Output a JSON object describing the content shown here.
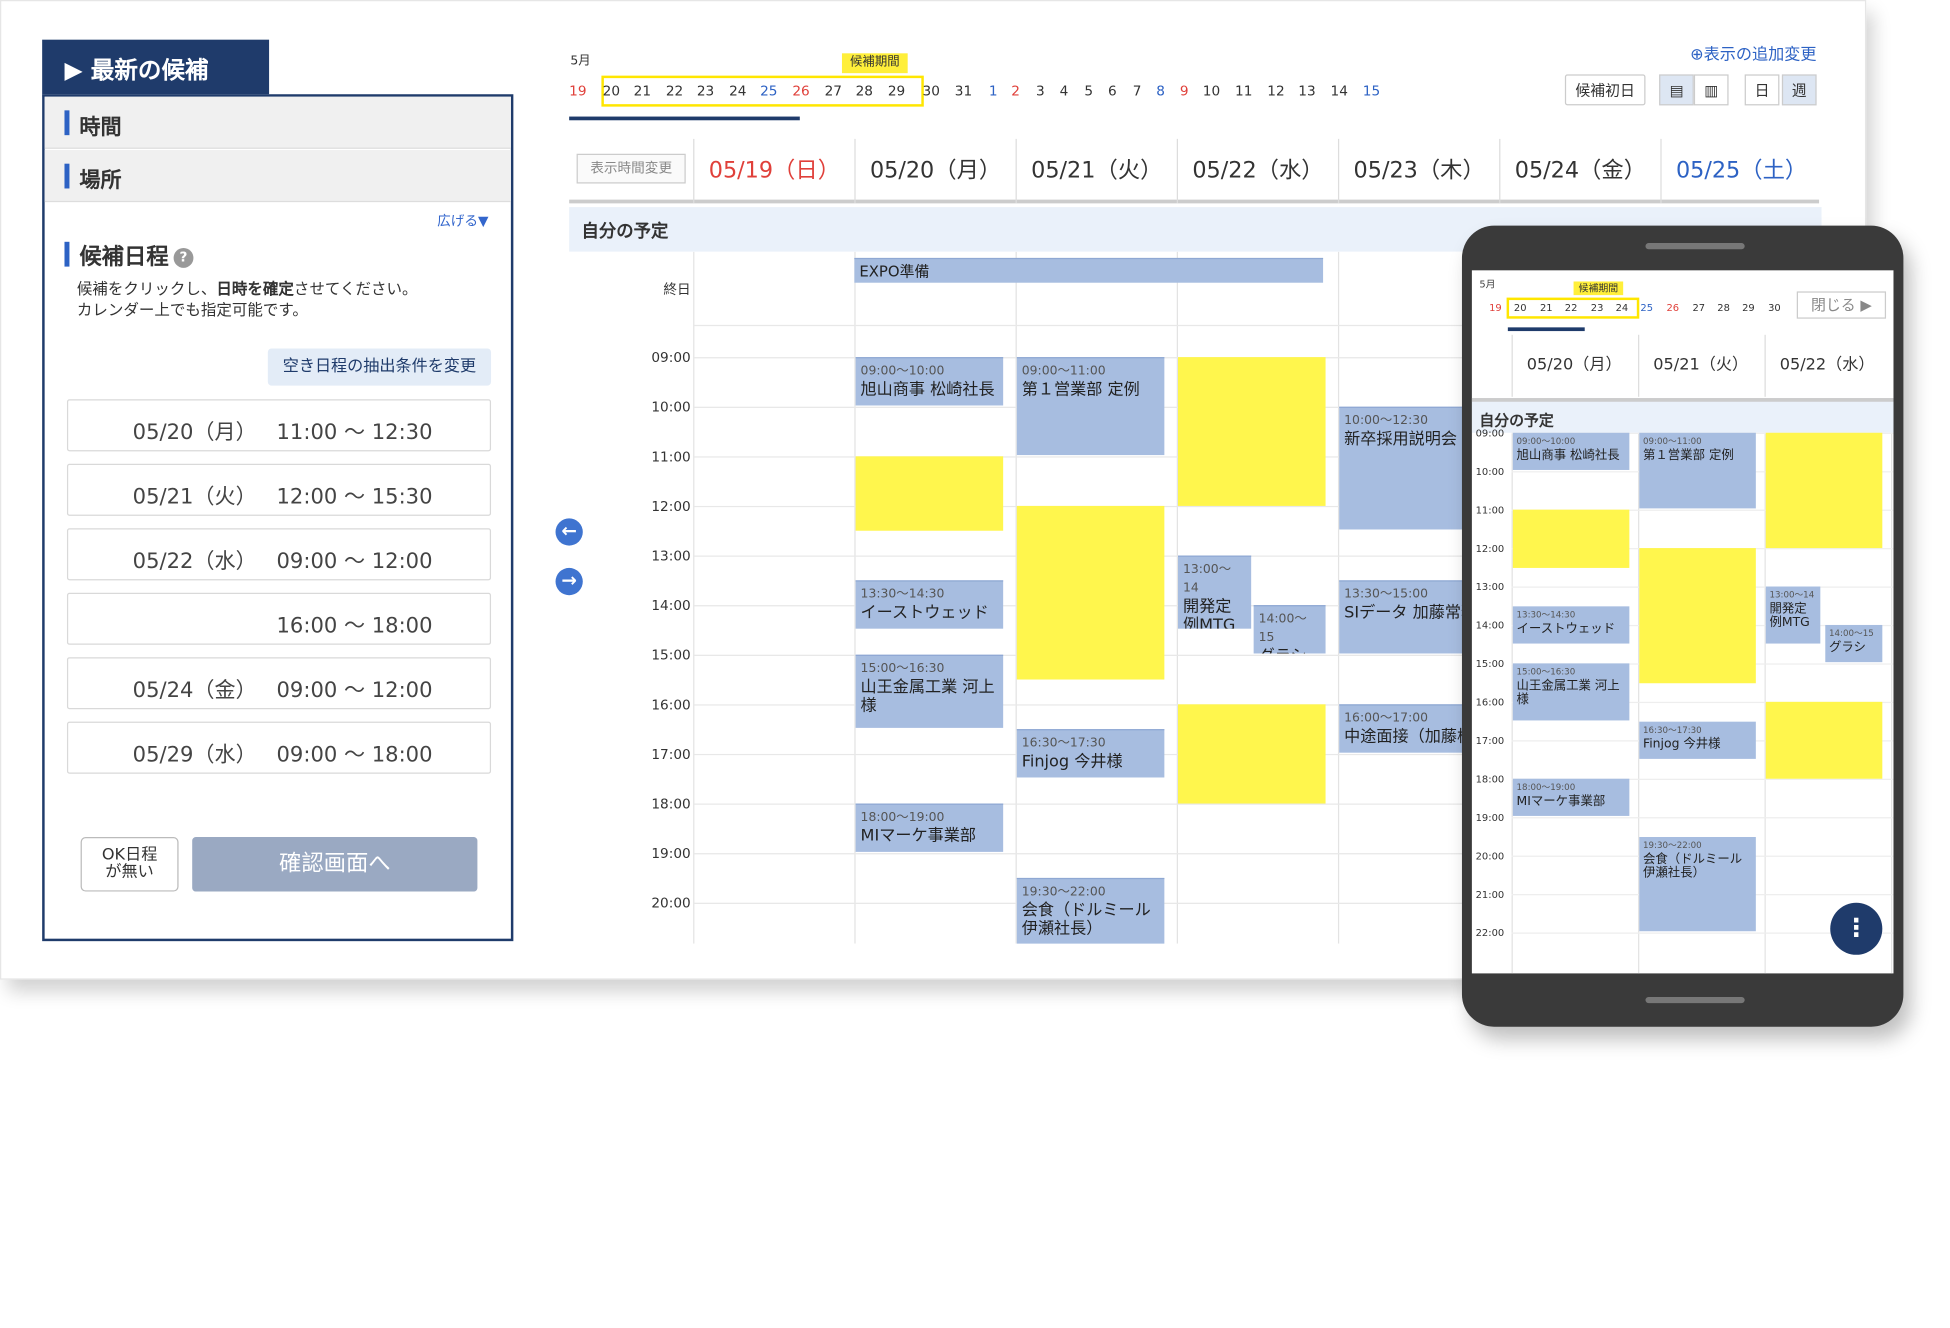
{
  "panel": {
    "header": "▶ 最新の候補",
    "time_label": "時間",
    "place_label": "場所",
    "expand": "広げる▼",
    "cand_title": "候補日程",
    "cand_desc_1a": "候補をクリックし、",
    "cand_desc_1b": "日時を確定",
    "cand_desc_1c": "させてください。",
    "cand_desc_2": "カレンダー上でも指定可能です。",
    "cond_button": "空き日程の抽出条件を変更",
    "slots": [
      {
        "date": "05/20（月）",
        "time": "11:00 〜 12:30"
      },
      {
        "date": "05/21（火）",
        "time": "12:00 〜 15:30"
      },
      {
        "date": "05/22（水）",
        "time": "09:00 〜 12:00"
      },
      {
        "date": "",
        "time": "16:00 〜 18:00"
      },
      {
        "date": "05/24（金）",
        "time": "09:00 〜 12:00"
      },
      {
        "date": "05/29（水）",
        "time": "09:00 〜 18:00"
      }
    ],
    "ok_button": "OK日程\nが無い",
    "confirm_button": "確認画面へ"
  },
  "strip": {
    "month": "5月",
    "period_label": "候補期間",
    "days": [
      "19",
      "20",
      "21",
      "22",
      "23",
      "24",
      "25",
      "26",
      "27",
      "28",
      "29",
      "30",
      "31",
      "1",
      "2",
      "3",
      "4",
      "5",
      "6",
      "7",
      "8",
      "9",
      "10",
      "11",
      "12",
      "13",
      "14",
      "15"
    ],
    "add_change": "⊕表示の追加変更",
    "first_day": "候補初日",
    "view_day": "日",
    "view_week": "週"
  },
  "calendar": {
    "show_time": "表示時間変更",
    "days": [
      "05/19（日）",
      "05/20（月）",
      "05/21（火）",
      "05/22（水）",
      "05/23（木）",
      "05/24（金）",
      "05/25（土）"
    ],
    "my_schedule": "自分の予定",
    "allday": "終日",
    "hours": [
      "09:00",
      "10:00",
      "11:00",
      "12:00",
      "13:00",
      "14:00",
      "15:00",
      "16:00",
      "17:00",
      "18:00",
      "19:00",
      "20:00"
    ],
    "allday_event": "EXPO準備",
    "events": [
      {
        "time": "09:00〜10:00",
        "title": "旭山商事 松崎社長"
      },
      {
        "time": "09:00〜11:00",
        "title": "第１営業部 定例"
      },
      {
        "time": "10:00〜12:30",
        "title": "新卒採用説明会"
      },
      {
        "time": "13:00〜14",
        "title": "開発定例MTG"
      },
      {
        "time": "13:30〜14:30",
        "title": "イーストウェッド"
      },
      {
        "time": "13:30〜15:00",
        "title": "SIデータ 加藤常務"
      },
      {
        "time": "14:00〜15",
        "title": "グラシ"
      },
      {
        "time": "15:00〜16:30",
        "title": "山王金属工業 河上様"
      },
      {
        "time": "16:00〜17:00",
        "title": "中途面接（加藤様）"
      },
      {
        "time": "16:30〜17:30",
        "title": "Finjog 今井様"
      },
      {
        "time": "18:00〜19:00",
        "title": "MIマーケ事業部"
      },
      {
        "time": "19:30〜22:00",
        "title": "会食（ドルミール伊瀬社長）"
      }
    ]
  },
  "phone": {
    "close": "閉じる ▶",
    "days": [
      "05/20（月）",
      "05/21（火）",
      "05/22（水）"
    ],
    "hours": [
      "09:00",
      "10:00",
      "11:00",
      "12:00",
      "13:00",
      "14:00",
      "15:00",
      "16:00",
      "17:00",
      "18:00",
      "19:00",
      "20:00",
      "21:00",
      "22:00"
    ],
    "fab": "⋮"
  },
  "colors": {
    "navy": "#1f3b6b",
    "candidate": "#fff64d",
    "event": "#a7bde0",
    "sunday": "#e0403a",
    "saturday": "#2d62c4"
  }
}
